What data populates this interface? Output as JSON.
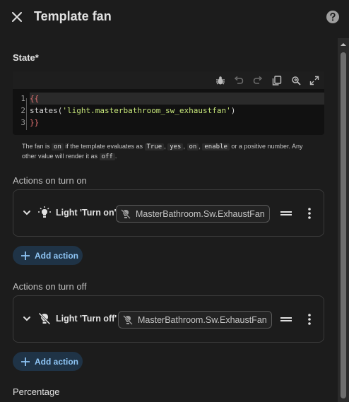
{
  "dialog": {
    "title": "Template fan"
  },
  "state": {
    "label": "State*",
    "code_lines": [
      [
        {
          "t": "{{",
          "c": "brace"
        }
      ],
      [
        {
          "t": "states(",
          "c": "fn"
        },
        {
          "t": "'light.masterbathroom_sw_exhaustfan'",
          "c": "str"
        },
        {
          "t": ")",
          "c": "fn"
        }
      ],
      [
        {
          "t": "}}",
          "c": "brace"
        }
      ]
    ],
    "line_numbers": [
      "1",
      "2",
      "3"
    ],
    "helper": {
      "p1": "The fan is",
      "c1": "on",
      "p2": "if the template evaluates as",
      "c2": "True",
      "p3": ",",
      "c3": "yes",
      "p4": ",",
      "c4": "on",
      "p5": ",",
      "c5": "enable",
      "p6": "or a positive number. Any other value will render it as",
      "c6": "off",
      "p7": "."
    }
  },
  "turn_on": {
    "label": "Actions on turn on",
    "action_title": "Light 'Turn on'",
    "target": "MasterBathroom.Sw.ExhaustFan",
    "add_label": "Add action"
  },
  "turn_off": {
    "label": "Actions on turn off",
    "action_title": "Light 'Turn off'",
    "target": "MasterBathroom.Sw.ExhaustFan",
    "add_label": "Add action"
  },
  "percentage": {
    "label": "Percentage"
  },
  "icons": {
    "close": "close-icon",
    "help": "help-icon",
    "toolbar": [
      "bug-icon",
      "undo-icon",
      "redo-icon",
      "copy-icon",
      "search-replace-icon",
      "fullscreen-icon"
    ],
    "light_on": "lightbulb-on-icon",
    "light_off": "lightbulb-off-icon",
    "drag": "drag-handle-icon",
    "more": "more-vertical-icon",
    "plus": "plus-icon"
  },
  "colors": {
    "background": "#1c1c1c",
    "accent": "#8ec5f5",
    "add_button_bg": "#1f3346",
    "string_token": "#c5e478",
    "brace_token": "#e57373"
  }
}
